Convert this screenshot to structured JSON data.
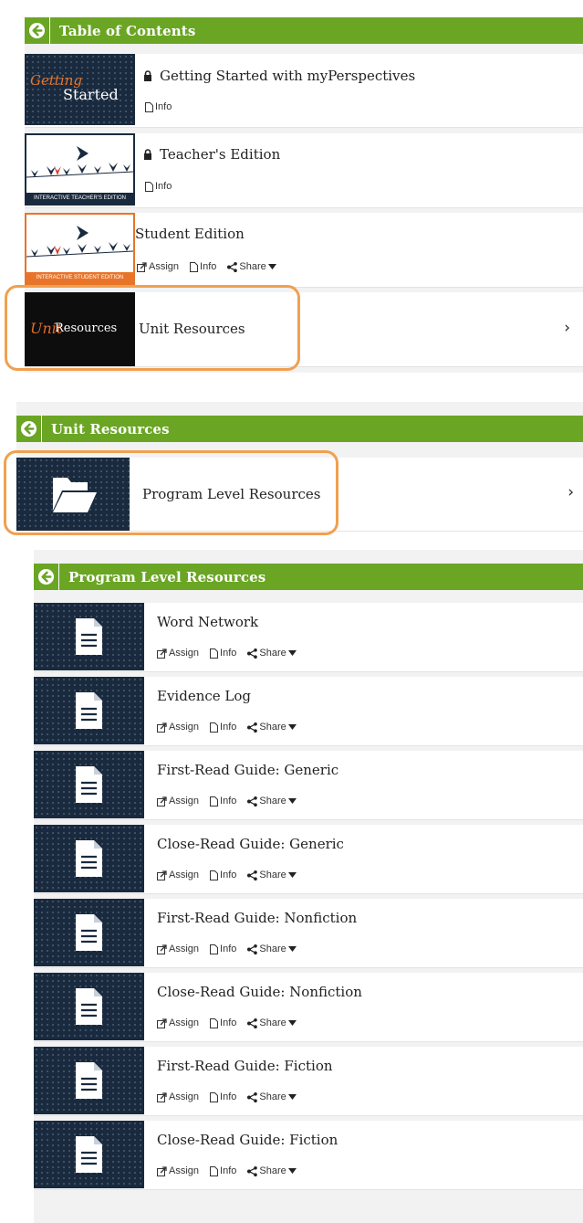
{
  "toc": {
    "title": "Table of Contents",
    "items": [
      {
        "title": "Getting Started with myPerspectives",
        "thumb_line1": "Getting",
        "thumb_line2": "Started",
        "info": "Info"
      },
      {
        "title": "Teacher's Edition",
        "thumb_caption": "INTERACTIVE TEACHER'S EDITION",
        "info": "Info"
      },
      {
        "title": "Student Edition",
        "thumb_caption": "INTERACTIVE STUDENT EDITION",
        "assign": "Assign",
        "info": "Info",
        "share": "Share"
      },
      {
        "title": "Unit Resources",
        "thumb_unit": "Unit",
        "thumb_resources": "Resources"
      }
    ]
  },
  "unit": {
    "title": "Unit Resources",
    "items": [
      {
        "title": "Program Level Resources"
      }
    ]
  },
  "program": {
    "title": "Program Level Resources",
    "actions": {
      "assign": "Assign",
      "info": "Info",
      "share": "Share"
    },
    "items": [
      {
        "title": "Word Network"
      },
      {
        "title": "Evidence Log"
      },
      {
        "title": "First-Read Guide: Generic"
      },
      {
        "title": "Close-Read Guide: Generic"
      },
      {
        "title": "First-Read Guide: Nonfiction"
      },
      {
        "title": "Close-Read Guide: Nonfiction"
      },
      {
        "title": "First-Read Guide: Fiction"
      },
      {
        "title": "Close-Read Guide: Fiction"
      }
    ]
  },
  "colors": {
    "header": "#6aa524",
    "highlight": "#f0a050",
    "thumb": "#1a2a3e"
  },
  "icons": [
    "back-arrow-icon",
    "lock-icon",
    "info-doc-icon",
    "assign-icon",
    "share-icon",
    "caret-down-icon",
    "chevron-right-icon",
    "folder-icon",
    "document-icon"
  ]
}
